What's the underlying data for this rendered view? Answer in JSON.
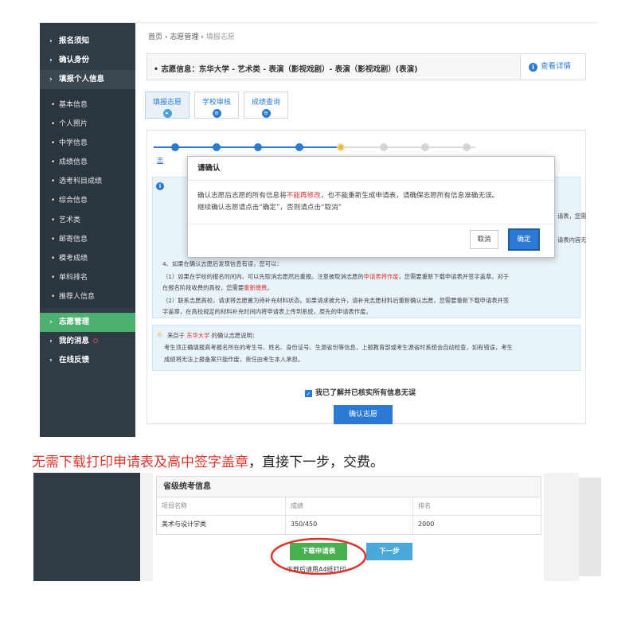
{
  "sidebar": {
    "items_top": [
      {
        "label": "报名须知",
        "arrow": "›"
      },
      {
        "label": "确认身份",
        "arrow": "›"
      },
      {
        "label": "填报个人信息",
        "arrow": "›"
      }
    ],
    "sub_items": [
      "基本信息",
      "个人照片",
      "中学信息",
      "成绩信息",
      "选考科目成绩",
      "综合信息",
      "艺术类",
      "邮寄信息",
      "模考成绩",
      "单科排名",
      "推荐人信息"
    ],
    "items_bottom": [
      {
        "label": "志愿管理",
        "arrow": "›"
      },
      {
        "label": "我的消息",
        "arrow": "›"
      },
      {
        "label": "在线反馈",
        "arrow": "›"
      }
    ]
  },
  "breadcrumb": {
    "home": "首页",
    "sep1": " › ",
    "section": "志愿管理",
    "sep2": " › ",
    "current": "填报志愿"
  },
  "info_bar": {
    "text": "• 志愿信息：东华大学 - 艺术类 - 表演（影视戏剧）- 表演（影视戏剧）(表演)",
    "detail_label": "查看详情",
    "detail_icon": "i"
  },
  "tabs": [
    {
      "label": "填报志愿",
      "icon": "▸"
    },
    {
      "label": "学校审核",
      "icon": "≡"
    },
    {
      "label": "成绩查询",
      "icon": "≡"
    }
  ],
  "steps_partial_text": "志",
  "notice": {
    "icon": "i",
    "right_cut_1": "请表，您需",
    "right_cut_2": "请表内容无",
    "line4": "4、如果在确认志愿后发现信息有误，您可以：",
    "line5a": "（1）如果在学校的报名时间内，可以先取消志愿然后重报。注意被取消志愿的",
    "line5b": "申请表将作废",
    "line5c": "，您需要重新下载申请表并签字盖章。对于",
    "line6a": "在报名阶段收费的高校，您需要",
    "line6b": "重新缴费",
    "line6c": "。",
    "line7": "（2）联系志愿高校，请求将志愿置为待补充材料状态。如果请求被允许，请补充志愿材料后重新确认志愿，您需要重新下载申请表并签",
    "line8": "字盖章，在高校规定的材料补充时间内将申请表上传到系统，原先的申请表作废。"
  },
  "school_note": {
    "icon": "☼",
    "prefix": "来自于",
    "school": "东华大学",
    "suffix": "的确认志愿说明：",
    "line2": "考生须正确填报高考报名所在的考生号、姓名、身份证号、生源省份等信息，上报教育部或考生源省时系统会自动检查，如有错误，考生",
    "line3": "成绩将无法上报备案只能作废，责任由考生本人承担。"
  },
  "checkbox": {
    "mark": "✓",
    "label": "我已了解并已核实所有信息无误"
  },
  "confirm_button": "确认志愿",
  "modal": {
    "title": "请确认",
    "line1a": "确认志愿后志愿的所有信息将",
    "line1b": "不能再修改",
    "line1c": "，也不能重新生成申请表，请确保志愿所有信息准确无误。",
    "line2": "继续确认志愿请点击“确定”，否则请点击“取消”",
    "cancel": "取消",
    "ok": "确定"
  },
  "caption": {
    "red": "无需下载打印申请表及高中签字盖章",
    "black": "，直接下一步，交费。"
  },
  "score_table": {
    "title": "省级统考信息",
    "headers": [
      "项目名称",
      "成绩",
      "排名"
    ],
    "rows": [
      [
        "美术与设计学类",
        "350/450",
        "2000"
      ]
    ]
  },
  "download_button": "下载申请表",
  "next_button": "下一步",
  "download_hint": "下载后请用A4纸打印",
  "colors": {
    "sidebar": "#2f3b45",
    "active": "#4cb070",
    "primary": "#2a7ad5",
    "red": "#e0332c",
    "green_btn": "#48b04f",
    "next_btn": "#4aa9da"
  }
}
